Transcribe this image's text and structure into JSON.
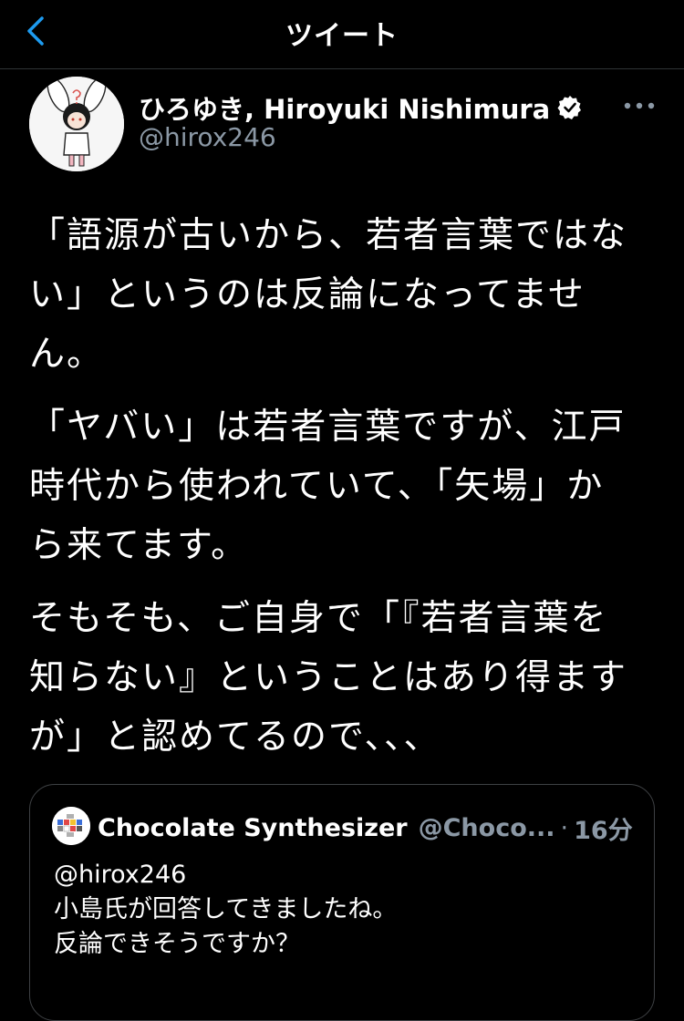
{
  "header": {
    "title": "ツイート"
  },
  "tweet": {
    "author_name": "ひろゆき, Hiroyuki Nishimura",
    "author_handle": "@hirox246",
    "paragraphs": [
      [
        "「語源が古いから、若者言葉ではな",
        "い」というのは反論になってませ",
        "ん。"
      ],
      [
        "「ヤバい」は若者言葉ですが、江戸",
        "時代から使われていて、「矢場」か",
        "ら来てます。"
      ],
      [
        "そもそも、ご自身で「『若者言葉を",
        "知らない』ということはあり得ます",
        "が」と認めてるので、、、"
      ]
    ]
  },
  "quoted_tweet": {
    "author_name": "Chocolate Synthesizer",
    "author_handle": "@Choco...",
    "separator": "·",
    "time": "16分",
    "lines": [
      "@hirox246",
      "小島氏が回答してきましたね。",
      "反論できそうですか？"
    ]
  },
  "colors": {
    "background": "#000000",
    "text": "#ffffff",
    "secondary_text": "#8b98a5",
    "accent": "#1d9bf0",
    "divider": "#2f3336"
  },
  "icons": {
    "back": "chevron-left-icon",
    "verified": "verified-badge-icon",
    "more": "more-horizontal-icon"
  }
}
